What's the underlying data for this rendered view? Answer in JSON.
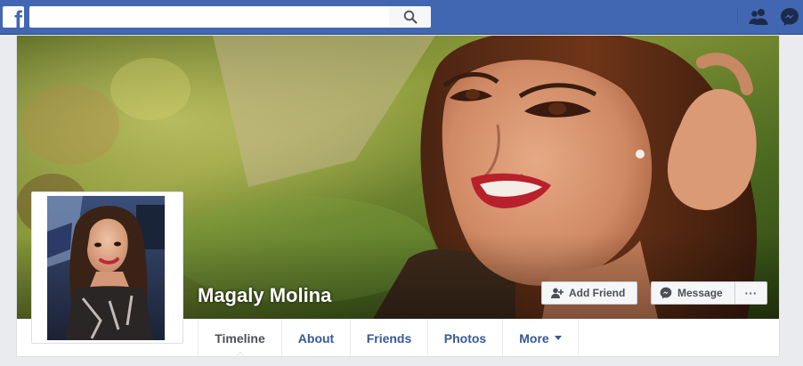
{
  "topbar": {
    "logo_letter": "f",
    "search": {
      "value": "",
      "placeholder": ""
    },
    "icons": [
      "facebook-logo-icon",
      "search-icon",
      "friend-requests-icon",
      "messenger-icon"
    ]
  },
  "profile": {
    "name": "Magaly Molina",
    "buttons": {
      "add_friend": "Add Friend",
      "message": "Message",
      "more": "···"
    }
  },
  "tabs": [
    {
      "label": "Timeline",
      "active": true
    },
    {
      "label": "About",
      "active": false
    },
    {
      "label": "Friends",
      "active": false
    },
    {
      "label": "Photos",
      "active": false
    },
    {
      "label": "More",
      "active": false,
      "has_caret": true
    }
  ],
  "colors": {
    "brand": "#4267b2",
    "link": "#365899",
    "page_bg": "#e9ebee"
  }
}
